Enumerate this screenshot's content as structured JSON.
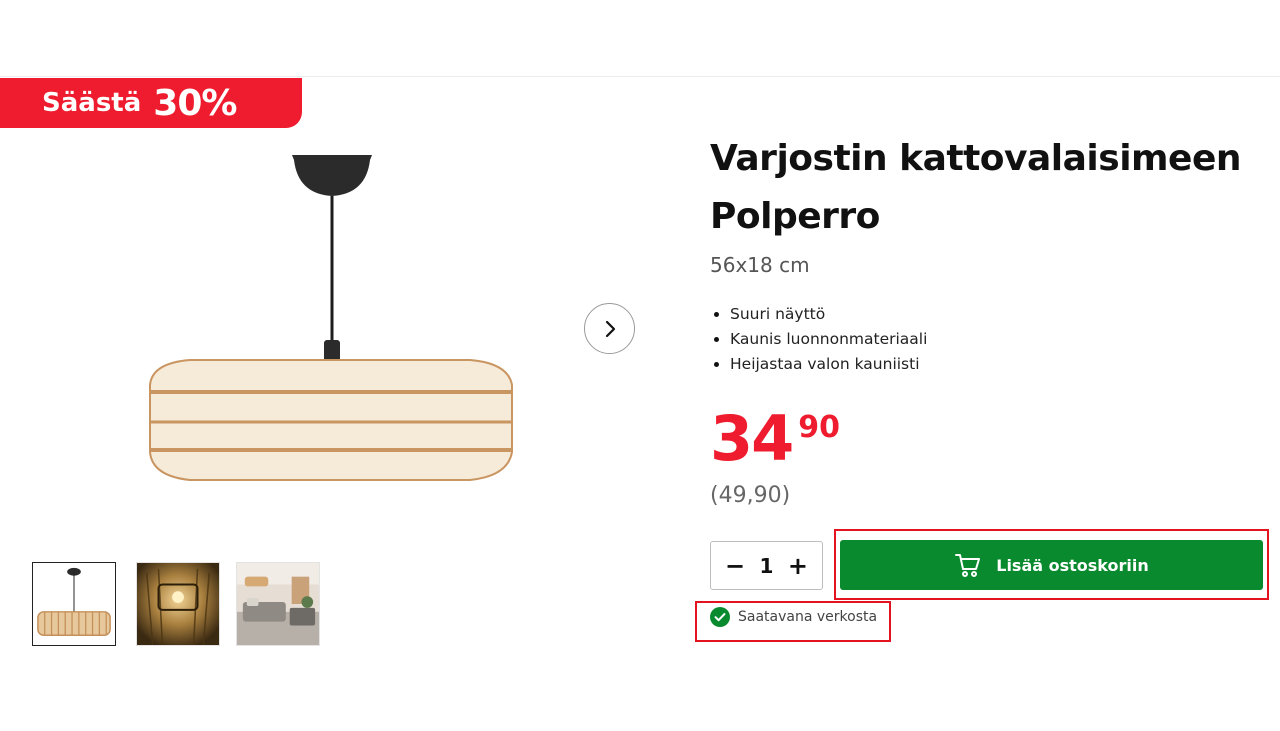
{
  "badge": {
    "save_text": "Säästä",
    "save_percent": "30%"
  },
  "product": {
    "title": "Varjostin kattovalaisimeen Polperro",
    "size": "56x18 cm",
    "features": [
      "Suuri näyttö",
      "Kaunis luonnonmateriaali",
      "Heijastaa valon kauniisti"
    ],
    "price_euros": "34",
    "price_cents": "90",
    "old_price": "(49,90)"
  },
  "quantity": {
    "minus": "−",
    "value": "1",
    "plus": "+"
  },
  "cart": {
    "label": "Lisää ostoskoriin"
  },
  "stock": {
    "label": "Saatavana verkosta"
  },
  "icons": {
    "next": "chevron-right-icon",
    "cart": "shopping-cart-icon",
    "stock": "check-circle-icon"
  },
  "colors": {
    "accent_red": "#ee1c2e",
    "cart_green": "#0a8a2e",
    "stock_green": "#0a8a2e",
    "highlight_red": "#e3141f"
  }
}
